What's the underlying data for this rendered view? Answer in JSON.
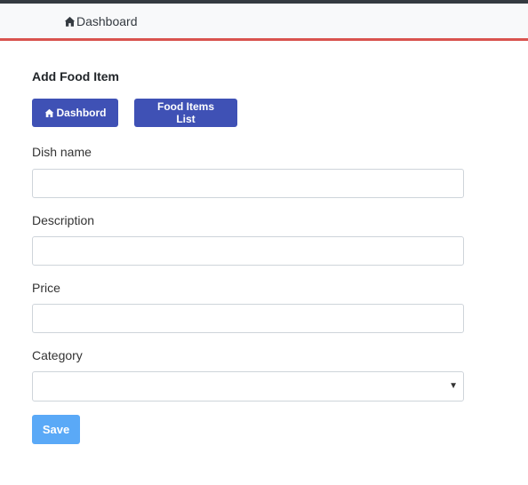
{
  "navbar": {
    "breadcrumb_label": "Dashboard",
    "breadcrumb_icon": "home-icon"
  },
  "page": {
    "title": "Add Food Item"
  },
  "actions": {
    "dashboard_label": "Dashbord",
    "dashboard_icon": "home-icon",
    "list_label": "Food Items List"
  },
  "form": {
    "dish_name": {
      "label": "Dish name",
      "value": "",
      "placeholder": ""
    },
    "description": {
      "label": "Description",
      "value": "",
      "placeholder": ""
    },
    "price": {
      "label": "Price",
      "value": "",
      "placeholder": ""
    },
    "category": {
      "label": "Category",
      "selected": "",
      "caret_icon": "caret-down-icon"
    },
    "save_label": "Save"
  },
  "colors": {
    "navbar_accent": "#d9534f",
    "primary": "#3f51b5",
    "save": "#5aa9f7"
  }
}
